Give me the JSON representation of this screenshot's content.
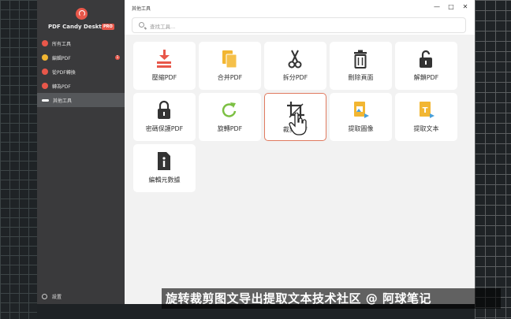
{
  "window_title": "其他工具",
  "app": {
    "name": "PDF Candy Desktop",
    "badge": "PRO"
  },
  "sidebar": {
    "items": [
      {
        "label": "所有工具",
        "color": "#e8574a"
      },
      {
        "label": "編輯PDF",
        "color": "#f2b632",
        "badge": "1"
      },
      {
        "label": "從PDF轉換",
        "color": "#e8574a"
      },
      {
        "label": "轉為PDF",
        "color": "#e8574a"
      },
      {
        "label": "其他工具",
        "color": "#ffffff"
      }
    ],
    "settings_label": "設置"
  },
  "search": {
    "placeholder": "查找工具..."
  },
  "window_controls": {
    "minimize": "—",
    "maximize": "□",
    "close": "✕"
  },
  "tools": [
    {
      "label": "壓縮PDF",
      "icon": "compress-icon"
    },
    {
      "label": "合并PDF",
      "icon": "merge-icon"
    },
    {
      "label": "拆分PDF",
      "icon": "scissors-icon"
    },
    {
      "label": "刪除頁面",
      "icon": "trash-icon"
    },
    {
      "label": "解鎖PDF",
      "icon": "unlock-icon"
    },
    {
      "label": "密碼保護PDF",
      "icon": "lock-icon"
    },
    {
      "label": "旋轉PDF",
      "icon": "rotate-icon"
    },
    {
      "label": "裁剪PDF",
      "icon": "crop-icon"
    },
    {
      "label": "提取圖像",
      "icon": "extract-image-icon"
    },
    {
      "label": "提取文本",
      "icon": "extract-text-icon"
    },
    {
      "label": "編輯元數據",
      "icon": "info-icon"
    }
  ],
  "subtitle": "旋转裁剪图文导出提取文本技术社区 @ 阿球笔记",
  "colors": {
    "accent": "#e8574a",
    "selected_border": "#e07a5f",
    "sidebar_bg": "#3a3a3c"
  }
}
